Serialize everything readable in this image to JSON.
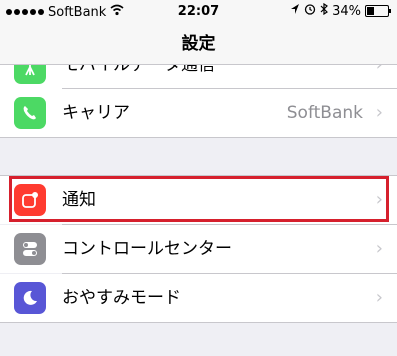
{
  "status_bar": {
    "carrier": "SoftBank",
    "time": "22:07",
    "battery": "34%",
    "battery_level": 0.34
  },
  "nav": {
    "title": "設定"
  },
  "rows": {
    "mobile_data": {
      "label": "モバイルデータ通信"
    },
    "carrier": {
      "label": "キャリア",
      "value": "SoftBank"
    },
    "notifications": {
      "label": "通知"
    },
    "control_center": {
      "label": "コントロールセンター"
    },
    "do_not_disturb": {
      "label": "おやすみモード"
    }
  },
  "colors": {
    "highlight": "#d6202d",
    "carrier_icon": "#4cd964",
    "notifications_icon": "#ff3b30",
    "control_icon": "#8e8e93",
    "dnd_icon": "#5856d6"
  }
}
